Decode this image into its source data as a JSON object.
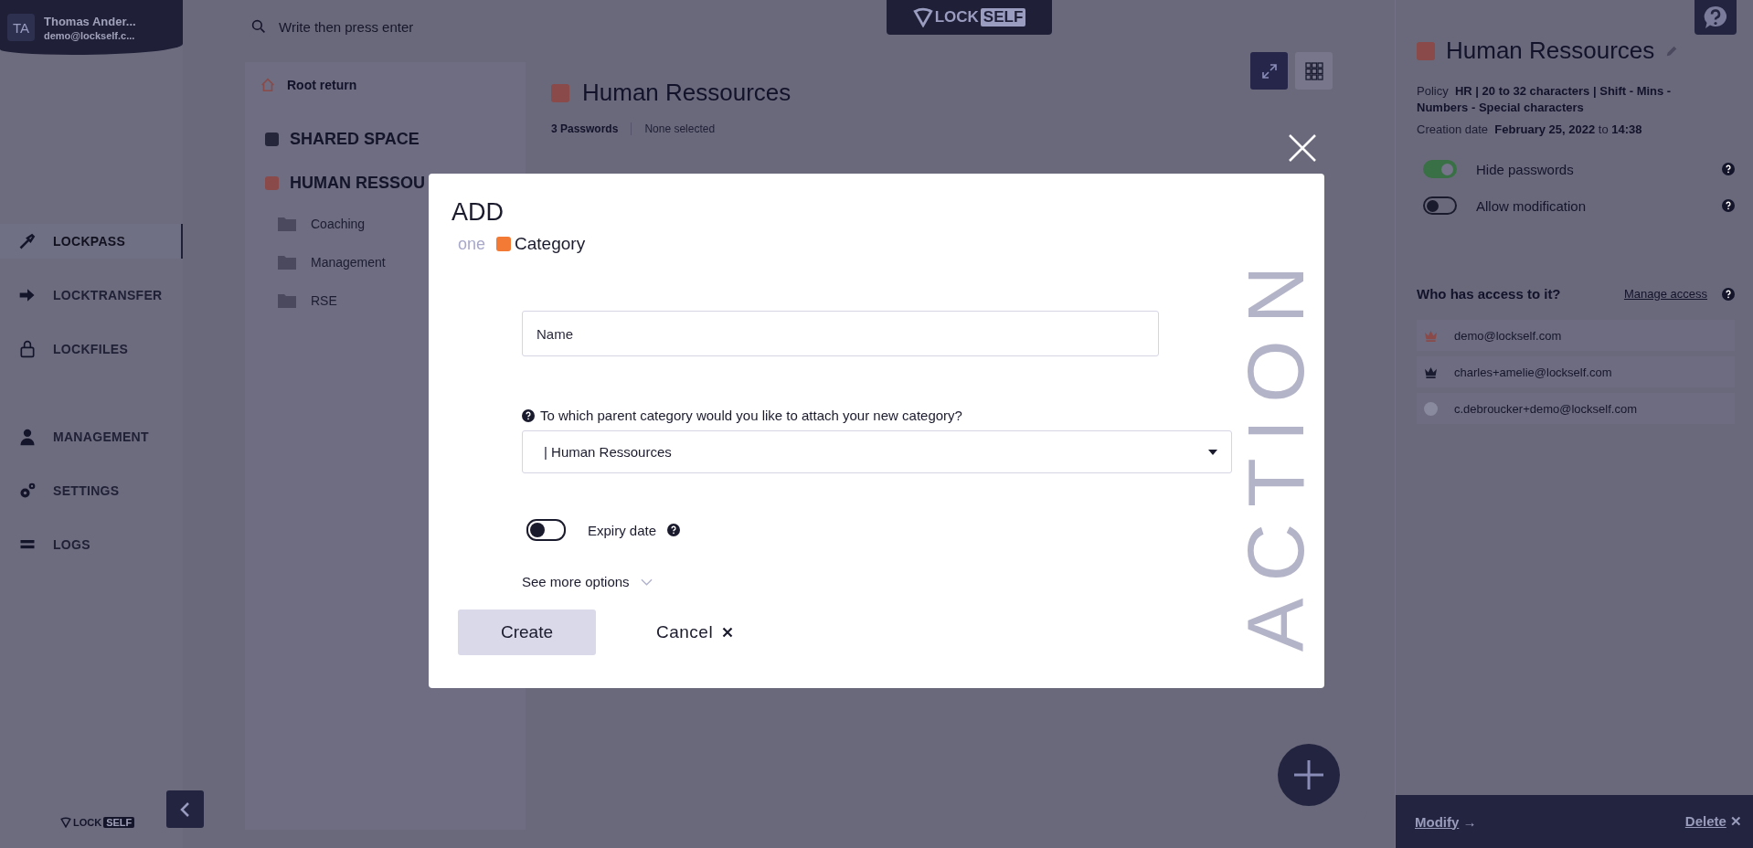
{
  "user": {
    "initials": "TA",
    "name": "Thomas Ander...",
    "email": "demo@lockself.c..."
  },
  "nav": [
    {
      "label": "LOCKPASS",
      "selected": true
    },
    {
      "label": "LOCKTRANSFER",
      "selected": false
    },
    {
      "label": "LOCKFILES",
      "selected": false
    },
    {
      "label": "MANAGEMENT",
      "selected": false
    },
    {
      "label": "SETTINGS",
      "selected": false
    },
    {
      "label": "LOGS",
      "selected": false
    }
  ],
  "bottom_logo": {
    "lock": "LOCK",
    "self": "SELF"
  },
  "top_logo": {
    "lock": "LOCK",
    "self": "SELF"
  },
  "search": {
    "placeholder": "Write then press enter"
  },
  "tree": {
    "root_return": "Root return",
    "spaces": [
      {
        "label": "SHARED SPACE",
        "color": "#26263a"
      },
      {
        "label": "HUMAN RESSOU",
        "color": "#8a4a4a",
        "children": [
          {
            "label": "Coaching"
          },
          {
            "label": "Management"
          },
          {
            "label": "RSE"
          }
        ]
      }
    ]
  },
  "content": {
    "title": "Human Ressources",
    "count": "3 Passwords",
    "selection": "None selected"
  },
  "details": {
    "title": "Human Ressources",
    "policy_label": "Policy",
    "policy_value": "HR | 20 to 32 characters | Shift - Mins - Numbers - Special characters",
    "creation_label": "Creation date",
    "creation_date": "February 25, 2022",
    "creation_sep": "to",
    "creation_time": "14:38",
    "toggles": [
      {
        "label": "Hide passwords",
        "on": true
      },
      {
        "label": "Allow modification",
        "on": false
      }
    ],
    "access_title": "Who has access to it?",
    "manage_access": "Manage access",
    "members": [
      {
        "email": "demo@lockself.com",
        "kind": "owner"
      },
      {
        "email": "charles+amelie@lockself.com",
        "kind": "admin"
      },
      {
        "email": "c.debroucker+demo@lockself.com",
        "kind": "user"
      }
    ],
    "modify": "Modify",
    "modify_arrow": "→",
    "delete": "Delete",
    "delete_mark": "✕"
  },
  "modal": {
    "title": "ADD",
    "prefix": "one",
    "subject": "Category",
    "name_placeholder": "Name",
    "parent_question": "To which parent category would you like to attach your new category?",
    "parent_value": "| Human Ressources",
    "expiry": {
      "label": "Expiry date",
      "on": false
    },
    "more_options": "See more options",
    "create": "Create",
    "cancel": "Cancel",
    "watermark": "ACTION"
  }
}
